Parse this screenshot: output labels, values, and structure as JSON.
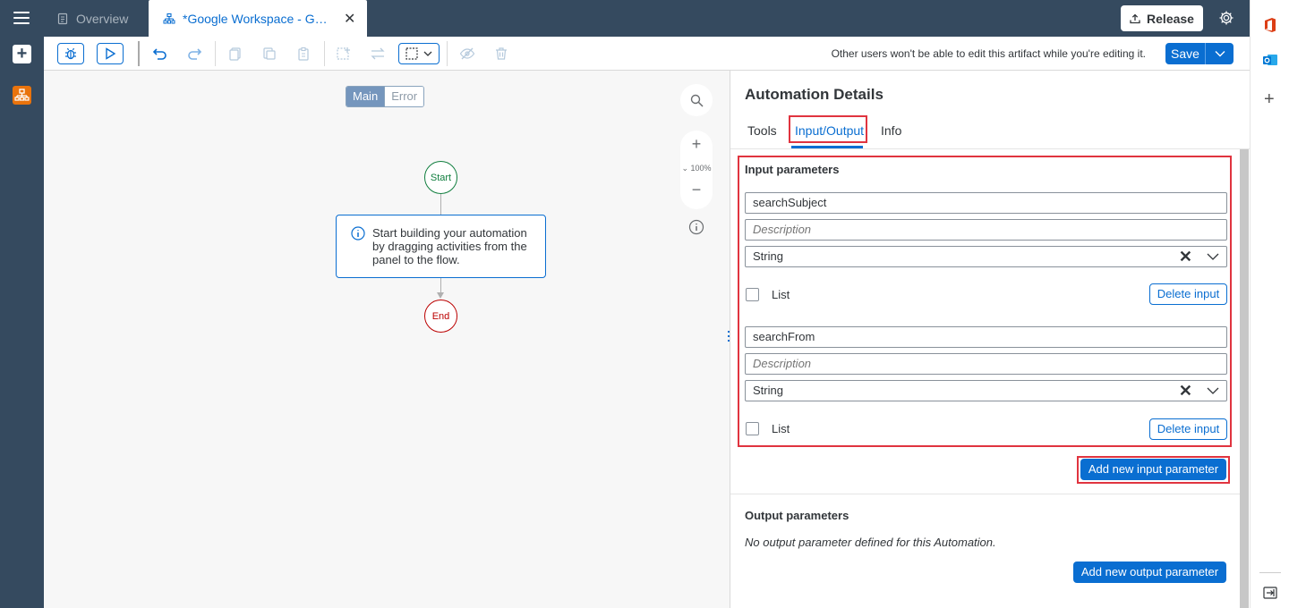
{
  "tabs": {
    "overview_label": "Overview",
    "active_label": "*Google Workspace - Gmail Automation"
  },
  "header": {
    "release_label": "Release"
  },
  "toolbar": {
    "lock_message": "Other users won't be able to edit this artifact while you're editing it.",
    "save_label": "Save"
  },
  "canvas": {
    "segments": [
      "Main",
      "Error"
    ],
    "start_label": "Start",
    "end_label": "End",
    "hint_text": "Start building your automation by dragging activities from the panel to the flow.",
    "zoom_level": "100%"
  },
  "panel": {
    "title": "Automation Details",
    "tabs": [
      "Tools",
      "Input/Output",
      "Info"
    ],
    "selected_tab": "Input/Output",
    "input_section_title": "Input parameters",
    "inputs": [
      {
        "name": "searchSubject",
        "description_placeholder": "Description",
        "type": "String",
        "list_label": "List",
        "list_checked": false,
        "delete_label": "Delete input"
      },
      {
        "name": "searchFrom",
        "description_placeholder": "Description",
        "type": "String",
        "list_label": "List",
        "list_checked": false,
        "delete_label": "Delete input"
      }
    ],
    "add_input_label": "Add new input parameter",
    "output_section_title": "Output parameters",
    "no_output_text": "No output parameter defined for this Automation.",
    "add_output_label": "Add new output parameter"
  },
  "colors": {
    "shell": "#354a5f",
    "accent": "#0a6ed1",
    "highlight": "#e0343f",
    "start": "#107e3e",
    "end": "#bb0000"
  }
}
